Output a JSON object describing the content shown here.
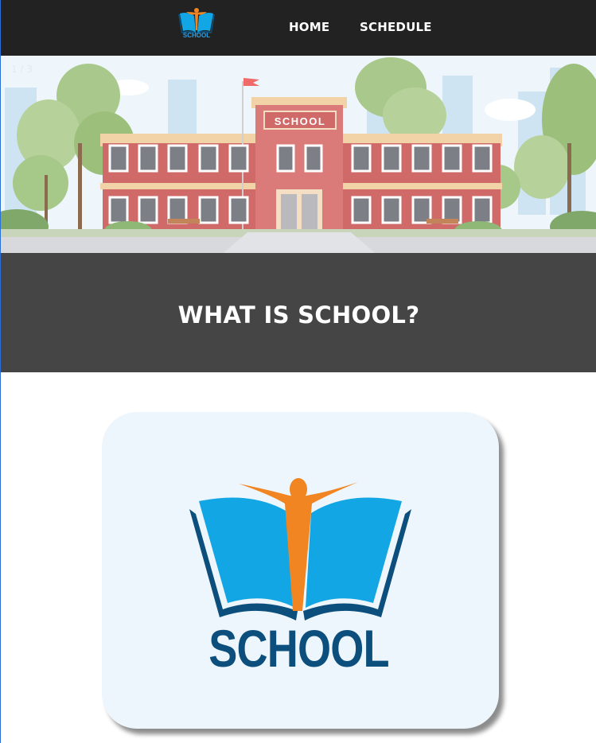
{
  "nav": {
    "logo_text": "SCHOOL",
    "links": [
      {
        "label": "HOME"
      },
      {
        "label": "SCHEDULE"
      }
    ]
  },
  "hero": {
    "slide_counter": "1 / 3",
    "building_sign": "SCHOOL"
  },
  "section": {
    "title": "WHAT IS SCHOOL?"
  },
  "card": {
    "logo_text": "SCHOOL"
  },
  "colors": {
    "navbar": "#222222",
    "title_band": "#454545",
    "card_bg": "#edf6fc",
    "logo_blue": "#0d4f7c",
    "logo_light_blue": "#12a6e4",
    "logo_orange": "#f08522"
  },
  "icons": [
    "school-logo-icon",
    "open-book-icon",
    "person-icon"
  ]
}
